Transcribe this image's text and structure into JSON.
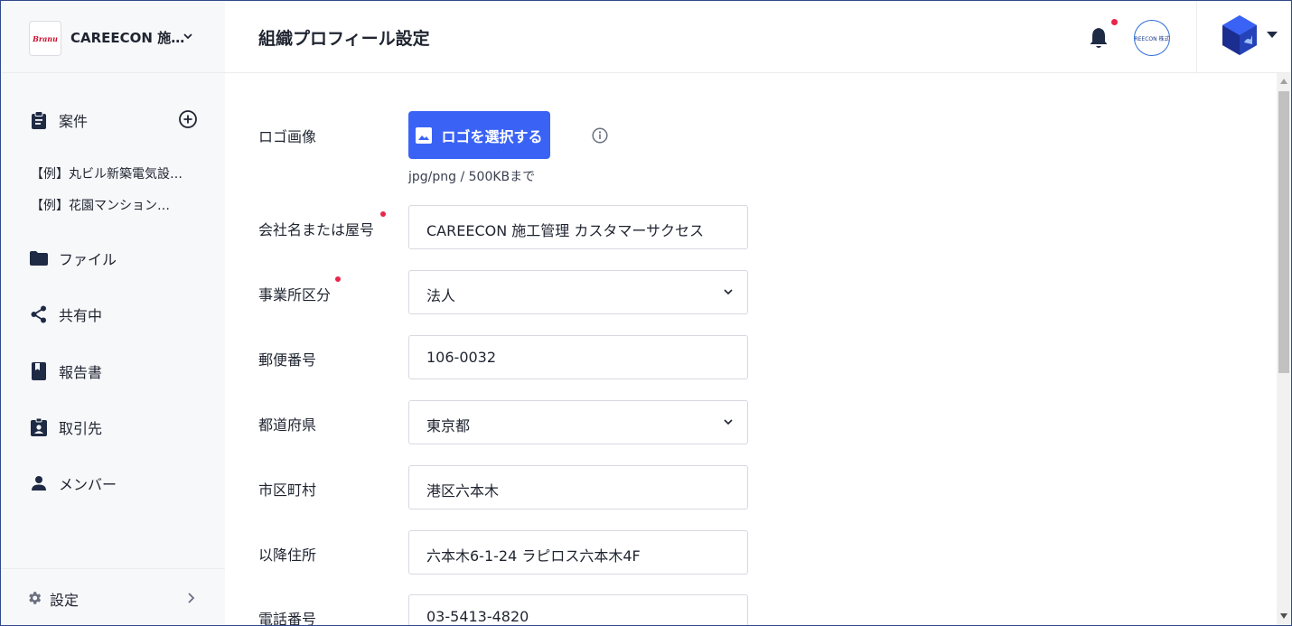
{
  "org": {
    "name": "CAREECON 施…",
    "logo_text": "Branu"
  },
  "nav": {
    "cases": "案件",
    "case_items": [
      "【例】丸ビル新築電気設…",
      "【例】花園マンション…"
    ],
    "files": "ファイル",
    "shared": "共有中",
    "reports": "報告書",
    "clients": "取引先",
    "members": "メンバー",
    "settings": "設定"
  },
  "header": {
    "title": "組織プロフィール設定",
    "company_avatar_text": "REECON 株式"
  },
  "form": {
    "logo_label": "ロゴ画像",
    "logo_button": "ロゴを選択する",
    "logo_hint": "jpg/png / 500KBまで",
    "company_label": "会社名または屋号",
    "company_value": "CAREECON 施工管理 カスタマーサクセス",
    "office_type_label": "事業所区分",
    "office_type_value": "法人",
    "postal_label": "郵便番号",
    "postal_value": "106-0032",
    "prefecture_label": "都道府県",
    "prefecture_value": "東京都",
    "city_label": "市区町村",
    "city_value": "港区六本木",
    "address_label": "以降住所",
    "address_value": "六本木6-1-24 ラピロス六本木4F",
    "phone_label": "電話番号",
    "phone_value": "03-5413-4820"
  },
  "colors": {
    "accent": "#3a63f5",
    "required_dot": "#e8254a",
    "sidebar_bg": "#f7f8fa",
    "text": "#1f2430"
  },
  "icons": {
    "cases": "clipboard-icon",
    "add": "plus-circle-icon",
    "files": "folder-icon",
    "shared": "share-icon",
    "reports": "book-icon",
    "clients": "badge-icon",
    "members": "person-icon",
    "settings": "gear-icon",
    "notifications": "bell-icon",
    "logo_button": "image-icon",
    "info": "info-icon"
  }
}
